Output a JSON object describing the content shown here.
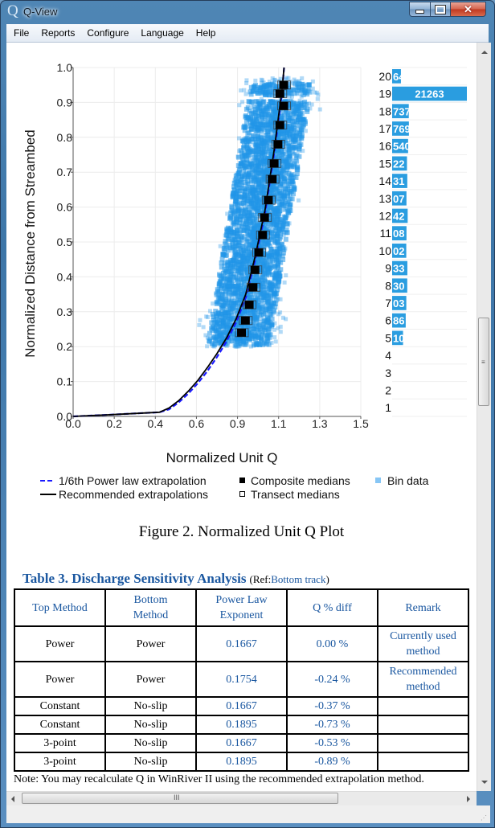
{
  "window": {
    "title": "Q-View",
    "app_icon": "Q",
    "controls": {
      "minimize": "minimize",
      "maximize": "maximize",
      "close": "x"
    }
  },
  "menu": [
    "File",
    "Reports",
    "Configure",
    "Language",
    "Help"
  ],
  "figure_caption": "Figure 2. Normalized Unit Q Plot",
  "chart_data": [
    {
      "type": "scatter",
      "title": "",
      "xlabel": "Normalized Unit Q",
      "ylabel": "Normalized Distance from Streambed",
      "xlim": [
        0.0,
        1.5
      ],
      "ylim": [
        0.0,
        1.0
      ],
      "x_tick_labels": [
        "0.0",
        "0.2",
        "0.4",
        "0.6",
        "0.9",
        "1.1",
        "1.3",
        "1.5"
      ],
      "y_tick_labels": [
        "0.0",
        "0.1",
        "0.2",
        "0.3",
        "0.4",
        "0.5",
        "0.6",
        "0.7",
        "0.8",
        "0.9",
        "1.0"
      ],
      "grid": true,
      "legend_position": "bottom",
      "legend": [
        {
          "label": "1/6th Power law extrapolation",
          "marker": "dashed-line",
          "color": "#1a1aff"
        },
        {
          "label": "Recommended extrapolations",
          "marker": "solid-line",
          "color": "#000000"
        },
        {
          "label": "Composite medians",
          "marker": "filled-square",
          "color": "#000000"
        },
        {
          "label": "Transect medians",
          "marker": "open-square",
          "color": "#000000"
        },
        {
          "label": "Bin data",
          "marker": "light-square",
          "color": "#87c6f5"
        }
      ],
      "series": [
        {
          "name": "1/6th Power law extrapolation",
          "style": "dashed",
          "color": "#1a1aff",
          "exponent": 0.1667,
          "x": [
            0.0,
            0.2,
            0.45,
            0.5,
            0.55,
            0.6,
            0.65,
            0.7,
            0.75,
            0.8,
            0.85,
            0.9,
            0.95,
            1.0,
            1.05,
            1.09,
            1.1
          ],
          "y": [
            0.0,
            0.005,
            0.012,
            0.02,
            0.04,
            0.065,
            0.095,
            0.13,
            0.17,
            0.215,
            0.27,
            0.34,
            0.45,
            0.58,
            0.76,
            0.93,
            1.0
          ]
        },
        {
          "name": "Recommended extrapolations",
          "style": "solid",
          "color": "#000000",
          "exponent": 0.1754,
          "x": [
            0.0,
            0.2,
            0.45,
            0.5,
            0.55,
            0.6,
            0.65,
            0.7,
            0.75,
            0.8,
            0.85,
            0.9,
            0.95,
            1.0,
            1.05,
            1.09,
            1.1
          ],
          "y": [
            0.0,
            0.005,
            0.012,
            0.024,
            0.045,
            0.072,
            0.103,
            0.14,
            0.18,
            0.225,
            0.28,
            0.35,
            0.46,
            0.59,
            0.77,
            0.94,
            1.0
          ]
        },
        {
          "name": "Composite medians",
          "color": "#000000",
          "x": [
            0.88,
            0.9,
            0.92,
            0.94,
            0.95,
            0.97,
            0.99,
            1.0,
            1.02,
            1.04,
            1.05,
            1.07,
            1.08,
            1.1,
            1.08,
            1.1
          ],
          "y": [
            0.24,
            0.275,
            0.32,
            0.37,
            0.42,
            0.47,
            0.52,
            0.57,
            0.62,
            0.68,
            0.725,
            0.78,
            0.835,
            0.89,
            0.925,
            0.95
          ]
        },
        {
          "name": "Bin data",
          "color": "#2196e8",
          "x_range": [
            0.55,
            1.35
          ],
          "y_range": [
            0.2,
            0.97
          ],
          "note": "dense cloud of points"
        }
      ]
    },
    {
      "type": "bar",
      "orientation": "horizontal",
      "title": "",
      "categories": [
        "20",
        "19",
        "18",
        "17",
        "16",
        "15",
        "14",
        "13",
        "12",
        "11",
        "10",
        "9",
        "8",
        "7",
        "6",
        "5",
        "4",
        "3",
        "2",
        "1"
      ],
      "values": [
        2500,
        21263,
        4737,
        4769,
        4540,
        4220,
        4310,
        4070,
        4420,
        4080,
        4020,
        4330,
        4300,
        4030,
        3860,
        3100,
        0,
        0,
        0,
        0
      ],
      "visible_labels": [
        "64",
        "21263",
        "737",
        "769",
        "540",
        "22",
        "31",
        "07",
        "42",
        "08",
        "02",
        "33",
        "30",
        "03",
        "86",
        "10",
        "",
        "",
        "",
        ""
      ],
      "color": "#2a9de0"
    }
  ],
  "table": {
    "title": "Table 3. Discharge Sensitivity Analysis",
    "ref_label": "(Ref:",
    "ref_value": "Bottom track",
    "ref_close": ")",
    "headers": [
      "Top Method",
      "Bottom Method",
      "Power Law Exponent",
      "Q % diff",
      "Remark"
    ],
    "rows": [
      {
        "top": "Power",
        "bottom": "Power",
        "exponent": "0.1667",
        "qdiff": "0.00 %",
        "remark": "Currently used method"
      },
      {
        "top": "Power",
        "bottom": "Power",
        "exponent": "0.1754",
        "qdiff": "-0.24 %",
        "remark": "Recommended method"
      },
      {
        "top": "Constant",
        "bottom": "No-slip",
        "exponent": "0.1667",
        "qdiff": "-0.37 %",
        "remark": ""
      },
      {
        "top": "Constant",
        "bottom": "No-slip",
        "exponent": "0.1895",
        "qdiff": "-0.73 %",
        "remark": ""
      },
      {
        "top": "3-point",
        "bottom": "No-slip",
        "exponent": "0.1667",
        "qdiff": "-0.53 %",
        "remark": ""
      },
      {
        "top": "3-point",
        "bottom": "No-slip",
        "exponent": "0.1895",
        "qdiff": "-0.89 %",
        "remark": ""
      }
    ]
  },
  "note": "Note: You may recalculate Q in WinRiver II using the recommended extrapolation method.",
  "scrollbars": {
    "vertical_grip": "≡",
    "horizontal_grip": "III"
  }
}
